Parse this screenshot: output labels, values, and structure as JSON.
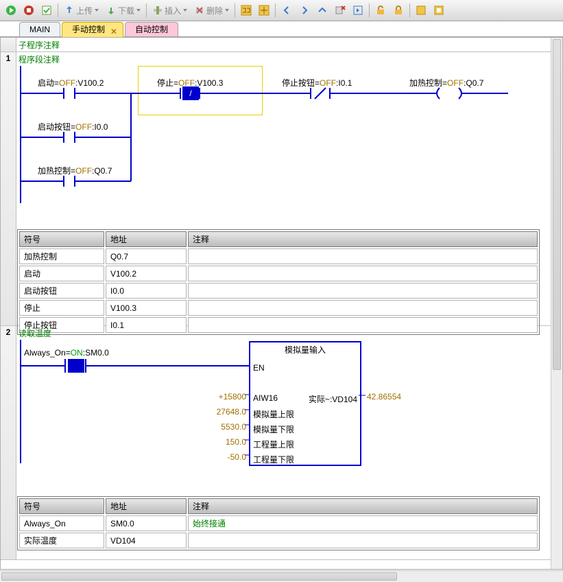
{
  "toolbar": {
    "upload": "上传",
    "download": "下载",
    "insert": "插入",
    "delete": "删除"
  },
  "tabs": {
    "main": "MAIN",
    "manual": "手动控制",
    "auto": "自动控制"
  },
  "sub_comment": "子程序注释",
  "network1": {
    "title": "程序段注释",
    "c1": {
      "name": "启动",
      "state": "OFF",
      "addr": "V100.2"
    },
    "c2": {
      "name": "停止",
      "state": "OFF",
      "addr": "V100.3"
    },
    "c3": {
      "name": "停止按钮",
      "state": "OFF",
      "addr": "I0.1"
    },
    "coil": {
      "name": "加热控制",
      "state": "OFF",
      "addr": "Q0.7"
    },
    "b2": {
      "name": "启动按钮",
      "state": "OFF",
      "addr": "I0.0"
    },
    "b3": {
      "name": "加热控制",
      "state": "OFF",
      "addr": "Q0.7"
    },
    "table": {
      "h1": "符号",
      "h2": "地址",
      "h3": "注释",
      "rows": [
        {
          "s": "加热控制",
          "a": "Q0.7",
          "c": ""
        },
        {
          "s": "启动",
          "a": "V100.2",
          "c": ""
        },
        {
          "s": "启动按钮",
          "a": "I0.0",
          "c": ""
        },
        {
          "s": "停止",
          "a": "V100.3",
          "c": ""
        },
        {
          "s": "停止按钮",
          "a": "I0.1",
          "c": ""
        }
      ]
    }
  },
  "network2": {
    "title": "读取温度",
    "c1": {
      "name": "Always_On",
      "state": "ON",
      "addr": "SM0.0"
    },
    "box": {
      "title": "模拟量输入",
      "en": "EN",
      "in1v": "+15800",
      "in1l": "AIW16",
      "in2v": "27648.0",
      "in2l": "模拟量上限",
      "in3v": "5530.0",
      "in3l": "模拟量下限",
      "in4v": "150.0",
      "in4l": "工程量上限",
      "in5v": "-50.0",
      "in5l": "工程量下限",
      "out_l": "实际~:VD104",
      "out_v": "42.86554"
    },
    "table": {
      "h1": "符号",
      "h2": "地址",
      "h3": "注释",
      "rows": [
        {
          "s": "Always_On",
          "a": "SM0.0",
          "c": "始终接通"
        },
        {
          "s": "实际温度",
          "a": "VD104",
          "c": ""
        }
      ]
    }
  }
}
